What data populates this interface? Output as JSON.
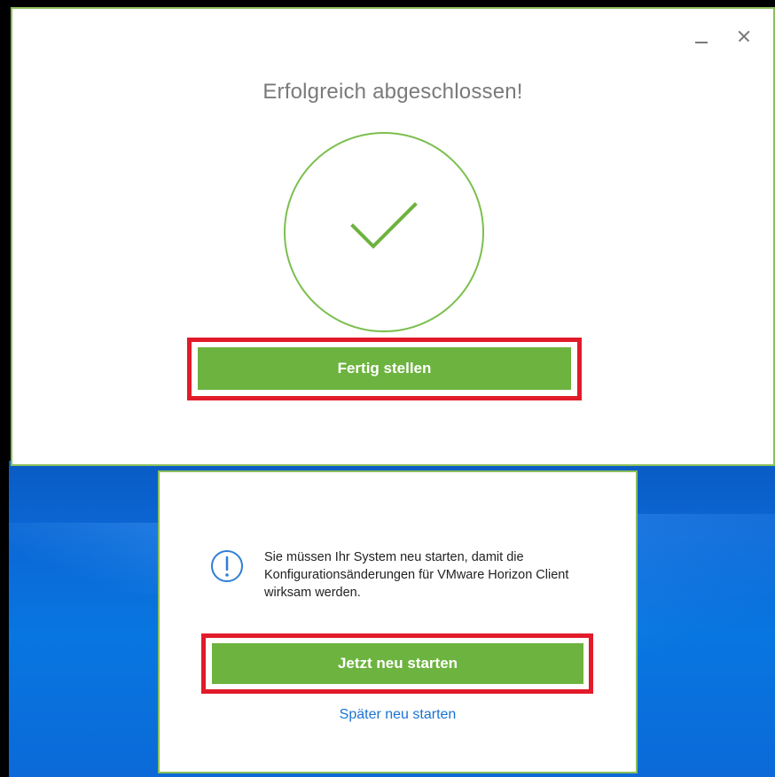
{
  "installer": {
    "title": "Erfolgreich abgeschlossen!",
    "finish_button_label": "Fertig stellen",
    "minimize_icon": "minimize-icon",
    "close_icon": "close-icon",
    "success_icon": "checkmark-circle-icon"
  },
  "restart_dialog": {
    "info_icon": "info-exclamation-icon",
    "message": "Sie müssen Ihr System neu starten, damit die Konfigurationsänderungen für VMware Horizon Client wirksam werden.",
    "restart_now_label": "Jetzt neu starten",
    "restart_later_label": "Später neu starten"
  },
  "colors": {
    "accent_green": "#6db33f",
    "circle_green": "#7bbf4f",
    "highlight_red": "#e21b2a",
    "link_blue": "#1a73d1",
    "info_blue": "#2f7fd6",
    "desktop_blue": "#0b68d6"
  }
}
